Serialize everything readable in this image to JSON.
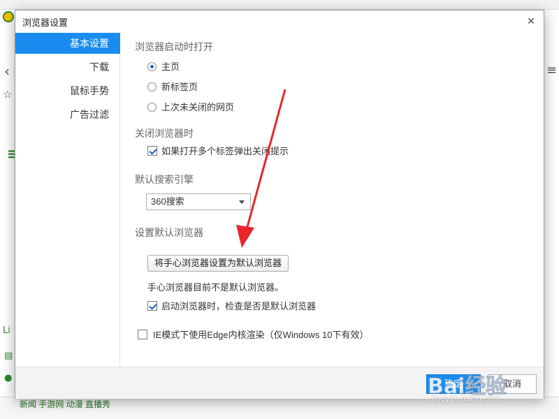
{
  "dialog": {
    "title": "浏览器设置",
    "close_glyph": "×"
  },
  "sidebar": {
    "items": [
      {
        "label": "基本设置",
        "active": true
      },
      {
        "label": "下载",
        "active": false
      },
      {
        "label": "鼠标手势",
        "active": false
      },
      {
        "label": "广告过滤",
        "active": false
      }
    ]
  },
  "startup": {
    "title": "浏览器启动时打开",
    "options": [
      {
        "label": "主页",
        "checked": true
      },
      {
        "label": "新标签页",
        "checked": false
      },
      {
        "label": "上次未关闭的网页",
        "checked": false
      }
    ]
  },
  "close_browser": {
    "title": "关闭浏览器时",
    "option_label": "如果打开多个标签弹出关闭提示",
    "checked": true
  },
  "search_engine": {
    "title": "默认搜索引擎",
    "selected": "360搜索"
  },
  "default_browser": {
    "title": "设置默认浏览器",
    "button_label": "将手心浏览器设置为默认浏览器",
    "status_text": "手心浏览器目前不是默认浏览器。",
    "check_label": "启动浏览器时，检查是否是默认浏览器",
    "check_checked": true
  },
  "ie_mode": {
    "label": "IE模式下使用Edge内核渲染（仅Windows 10下有效）",
    "checked": false
  },
  "footer": {
    "ok_label": "确定",
    "cancel_label": "取消"
  },
  "watermark": {
    "logo": "Bai经验",
    "sub": "jingyan.baidu.com"
  },
  "background": {
    "bottom_text": "新闻  手游网  动漫  直播秀"
  },
  "colors": {
    "accent": "#1a8cf0",
    "annotation_arrow": "#e8262a"
  }
}
